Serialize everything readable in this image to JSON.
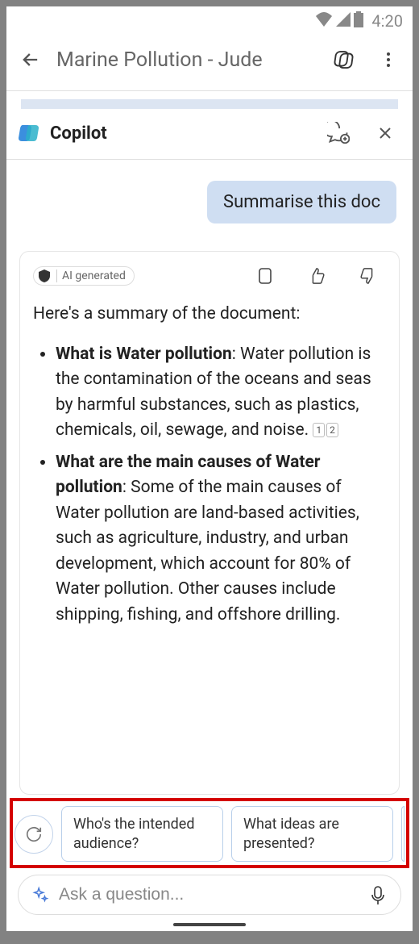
{
  "status": {
    "time": "4:20"
  },
  "header": {
    "title": "Marine Pollution - Jude"
  },
  "copilot": {
    "title": "Copilot"
  },
  "user_message": "Summarise this doc",
  "ai_badge": "AI generated",
  "summary": {
    "intro": "Here's a summary of the document:",
    "items": [
      {
        "heading": "What is Water pollution",
        "body": ": Water pollution is the contamination of the oceans and seas by harmful substances, such as plastics, chemicals, oil, sewage, and noise.",
        "citations": [
          "1",
          "2"
        ]
      },
      {
        "heading": "What are the main causes of Water pollution",
        "body": ": Some of the main causes of Water pollution are land-based activities, such as agriculture, industry, and urban development, which account for 80% of Water pollution. Other causes include shipping, fishing, and offshore drilling.",
        "citations": []
      }
    ]
  },
  "suggestions": [
    "Who's the intended audience?",
    "What ideas are presented?"
  ],
  "input": {
    "placeholder": "Ask a question..."
  }
}
